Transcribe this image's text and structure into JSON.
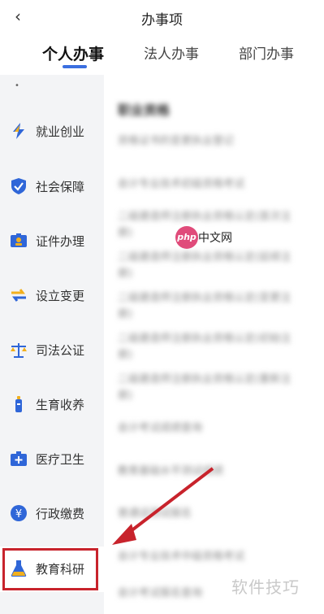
{
  "header": {
    "title": "办事项",
    "back_icon": "chevron-left-icon"
  },
  "tabs": [
    {
      "label": "个人办事",
      "active": true
    },
    {
      "label": "法人办事",
      "active": false
    },
    {
      "label": "部门办事",
      "active": false
    }
  ],
  "sidebar": {
    "items": [
      {
        "label": "就业创业",
        "icon": "lightning-icon"
      },
      {
        "label": "社会保障",
        "icon": "shield-icon"
      },
      {
        "label": "证件办理",
        "icon": "id-card-icon"
      },
      {
        "label": "设立变更",
        "icon": "swap-arrows-icon"
      },
      {
        "label": "司法公证",
        "icon": "scales-icon"
      },
      {
        "label": "生育收养",
        "icon": "baby-bottle-icon"
      },
      {
        "label": "医疗卫生",
        "icon": "medical-kit-icon"
      },
      {
        "label": "行政缴费",
        "icon": "yen-coin-icon"
      },
      {
        "label": "教育科研",
        "icon": "flask-icon",
        "highlighted": true
      }
    ]
  },
  "content": {
    "section_title": "职业资格",
    "items": [
      "资格证书的变更执业登记",
      "会计专业技术初级资格考试",
      "二级建造师注册执业资格认定(首次注册)",
      "二级建造师注册执业资格认定(延续注册)",
      "二级建造师注册执业资格认定(变更注册)",
      "二级建造师注册执业资格认定(初始注册)",
      "二级建造师注册执业资格认定(重新注册)",
      "会计考试成绩查询",
      "教育基础水平测试成绩",
      "普通话测试报名",
      "会计专业技术中级资格考试",
      "会计考试报名查询"
    ]
  },
  "watermarks": {
    "php_logo": "php",
    "php_site": "中文网",
    "corner": "软件技巧"
  },
  "colors": {
    "accent": "#3b6fe0",
    "highlight_red": "#c8232c",
    "icon_blue": "#2f66d8",
    "icon_yellow": "#f2b01e"
  }
}
